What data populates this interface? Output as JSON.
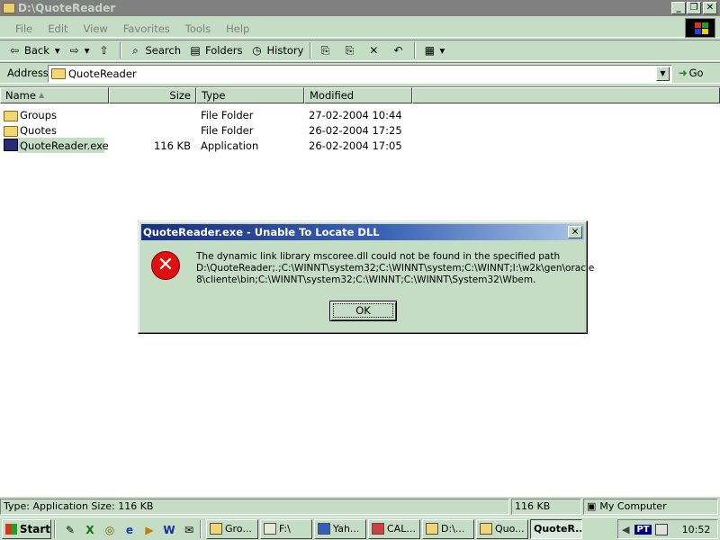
{
  "window": {
    "title": "D:\\QuoteReader",
    "min": "_",
    "max": "❐",
    "close": "✕"
  },
  "menu": [
    "File",
    "Edit",
    "View",
    "Favorites",
    "Tools",
    "Help"
  ],
  "toolbar": {
    "back": "Back",
    "back_icon": "⇦",
    "forward_icon": "⇨",
    "dropdown": "▾",
    "up_icon": "⇧",
    "search": "Search",
    "search_icon": "⌕",
    "folders": "Folders",
    "folders_icon": "▤",
    "history": "History",
    "history_icon": "◷",
    "move_icon": "⎘",
    "copy_icon": "⎘",
    "delete_icon": "✕",
    "undo_icon": "↶",
    "views_icon": "▦"
  },
  "address": {
    "label": "Address",
    "value": "QuoteReader",
    "dropdown": "▼",
    "go": "Go",
    "go_icon": "➜"
  },
  "columns": {
    "name": "Name",
    "sort": "▲",
    "size": "Size",
    "type": "Type",
    "modified": "Modified"
  },
  "files": [
    {
      "name": "Groups",
      "size": "",
      "type": "File Folder",
      "modified": "27-02-2004 10:44"
    },
    {
      "name": "Quotes",
      "size": "",
      "type": "File Folder",
      "modified": "26-02-2004 17:25"
    },
    {
      "name": "QuoteReader.exe",
      "size": "116 KB",
      "type": "Application",
      "modified": "26-02-2004 17:05"
    }
  ],
  "dialog": {
    "title": "QuoteReader.exe - Unable To Locate DLL",
    "close": "✕",
    "icon": "✕",
    "line1": "The dynamic link library mscoree.dll could not be found in the specified path",
    "line2": "D:\\QuoteReader;.;C:\\WINNT\\system32;C:\\WINNT\\system;C:\\WINNT;I:\\w2k\\gen\\oracle",
    "line3": "8\\cliente\\bin;C:\\WINNT\\system32;C:\\WINNT;C:\\WINNT\\System32\\Wbem.",
    "ok": "OK"
  },
  "status": {
    "left": "Type: Application Size: 116 KB",
    "size": "116 KB",
    "zone": "My Computer",
    "zone_icon": "▣"
  },
  "taskbar": {
    "start": "Start",
    "quicklaunch": [
      "✎",
      "X",
      "◎",
      "e",
      "▶",
      "W",
      "✉"
    ],
    "tasks": [
      "Gro...",
      "F:\\",
      "Yah...",
      "CAL...",
      "D:\\...",
      "Quo...",
      "QuoteR..."
    ],
    "tray": {
      "volume": "◀",
      "lang": "PT",
      "clock": "10:52"
    }
  }
}
